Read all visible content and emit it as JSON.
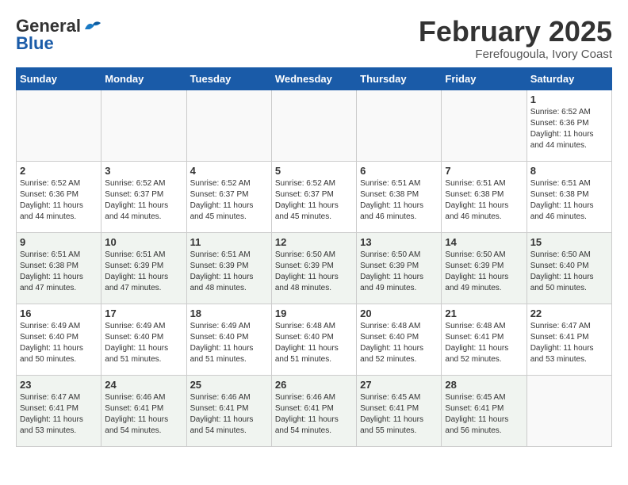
{
  "logo": {
    "general": "General",
    "blue": "Blue"
  },
  "title": "February 2025",
  "location": "Ferefougoula, Ivory Coast",
  "days_of_week": [
    "Sunday",
    "Monday",
    "Tuesday",
    "Wednesday",
    "Thursday",
    "Friday",
    "Saturday"
  ],
  "weeks": [
    [
      {
        "day": "",
        "info": ""
      },
      {
        "day": "",
        "info": ""
      },
      {
        "day": "",
        "info": ""
      },
      {
        "day": "",
        "info": ""
      },
      {
        "day": "",
        "info": ""
      },
      {
        "day": "",
        "info": ""
      },
      {
        "day": "1",
        "info": "Sunrise: 6:52 AM\nSunset: 6:36 PM\nDaylight: 11 hours\nand 44 minutes."
      }
    ],
    [
      {
        "day": "2",
        "info": "Sunrise: 6:52 AM\nSunset: 6:36 PM\nDaylight: 11 hours\nand 44 minutes."
      },
      {
        "day": "3",
        "info": "Sunrise: 6:52 AM\nSunset: 6:37 PM\nDaylight: 11 hours\nand 44 minutes."
      },
      {
        "day": "4",
        "info": "Sunrise: 6:52 AM\nSunset: 6:37 PM\nDaylight: 11 hours\nand 45 minutes."
      },
      {
        "day": "5",
        "info": "Sunrise: 6:52 AM\nSunset: 6:37 PM\nDaylight: 11 hours\nand 45 minutes."
      },
      {
        "day": "6",
        "info": "Sunrise: 6:51 AM\nSunset: 6:38 PM\nDaylight: 11 hours\nand 46 minutes."
      },
      {
        "day": "7",
        "info": "Sunrise: 6:51 AM\nSunset: 6:38 PM\nDaylight: 11 hours\nand 46 minutes."
      },
      {
        "day": "8",
        "info": "Sunrise: 6:51 AM\nSunset: 6:38 PM\nDaylight: 11 hours\nand 46 minutes."
      }
    ],
    [
      {
        "day": "9",
        "info": "Sunrise: 6:51 AM\nSunset: 6:38 PM\nDaylight: 11 hours\nand 47 minutes."
      },
      {
        "day": "10",
        "info": "Sunrise: 6:51 AM\nSunset: 6:39 PM\nDaylight: 11 hours\nand 47 minutes."
      },
      {
        "day": "11",
        "info": "Sunrise: 6:51 AM\nSunset: 6:39 PM\nDaylight: 11 hours\nand 48 minutes."
      },
      {
        "day": "12",
        "info": "Sunrise: 6:50 AM\nSunset: 6:39 PM\nDaylight: 11 hours\nand 48 minutes."
      },
      {
        "day": "13",
        "info": "Sunrise: 6:50 AM\nSunset: 6:39 PM\nDaylight: 11 hours\nand 49 minutes."
      },
      {
        "day": "14",
        "info": "Sunrise: 6:50 AM\nSunset: 6:39 PM\nDaylight: 11 hours\nand 49 minutes."
      },
      {
        "day": "15",
        "info": "Sunrise: 6:50 AM\nSunset: 6:40 PM\nDaylight: 11 hours\nand 50 minutes."
      }
    ],
    [
      {
        "day": "16",
        "info": "Sunrise: 6:49 AM\nSunset: 6:40 PM\nDaylight: 11 hours\nand 50 minutes."
      },
      {
        "day": "17",
        "info": "Sunrise: 6:49 AM\nSunset: 6:40 PM\nDaylight: 11 hours\nand 51 minutes."
      },
      {
        "day": "18",
        "info": "Sunrise: 6:49 AM\nSunset: 6:40 PM\nDaylight: 11 hours\nand 51 minutes."
      },
      {
        "day": "19",
        "info": "Sunrise: 6:48 AM\nSunset: 6:40 PM\nDaylight: 11 hours\nand 51 minutes."
      },
      {
        "day": "20",
        "info": "Sunrise: 6:48 AM\nSunset: 6:40 PM\nDaylight: 11 hours\nand 52 minutes."
      },
      {
        "day": "21",
        "info": "Sunrise: 6:48 AM\nSunset: 6:41 PM\nDaylight: 11 hours\nand 52 minutes."
      },
      {
        "day": "22",
        "info": "Sunrise: 6:47 AM\nSunset: 6:41 PM\nDaylight: 11 hours\nand 53 minutes."
      }
    ],
    [
      {
        "day": "23",
        "info": "Sunrise: 6:47 AM\nSunset: 6:41 PM\nDaylight: 11 hours\nand 53 minutes."
      },
      {
        "day": "24",
        "info": "Sunrise: 6:46 AM\nSunset: 6:41 PM\nDaylight: 11 hours\nand 54 minutes."
      },
      {
        "day": "25",
        "info": "Sunrise: 6:46 AM\nSunset: 6:41 PM\nDaylight: 11 hours\nand 54 minutes."
      },
      {
        "day": "26",
        "info": "Sunrise: 6:46 AM\nSunset: 6:41 PM\nDaylight: 11 hours\nand 54 minutes."
      },
      {
        "day": "27",
        "info": "Sunrise: 6:45 AM\nSunset: 6:41 PM\nDaylight: 11 hours\nand 55 minutes."
      },
      {
        "day": "28",
        "info": "Sunrise: 6:45 AM\nSunset: 6:41 PM\nDaylight: 11 hours\nand 56 minutes."
      },
      {
        "day": "",
        "info": ""
      }
    ]
  ]
}
